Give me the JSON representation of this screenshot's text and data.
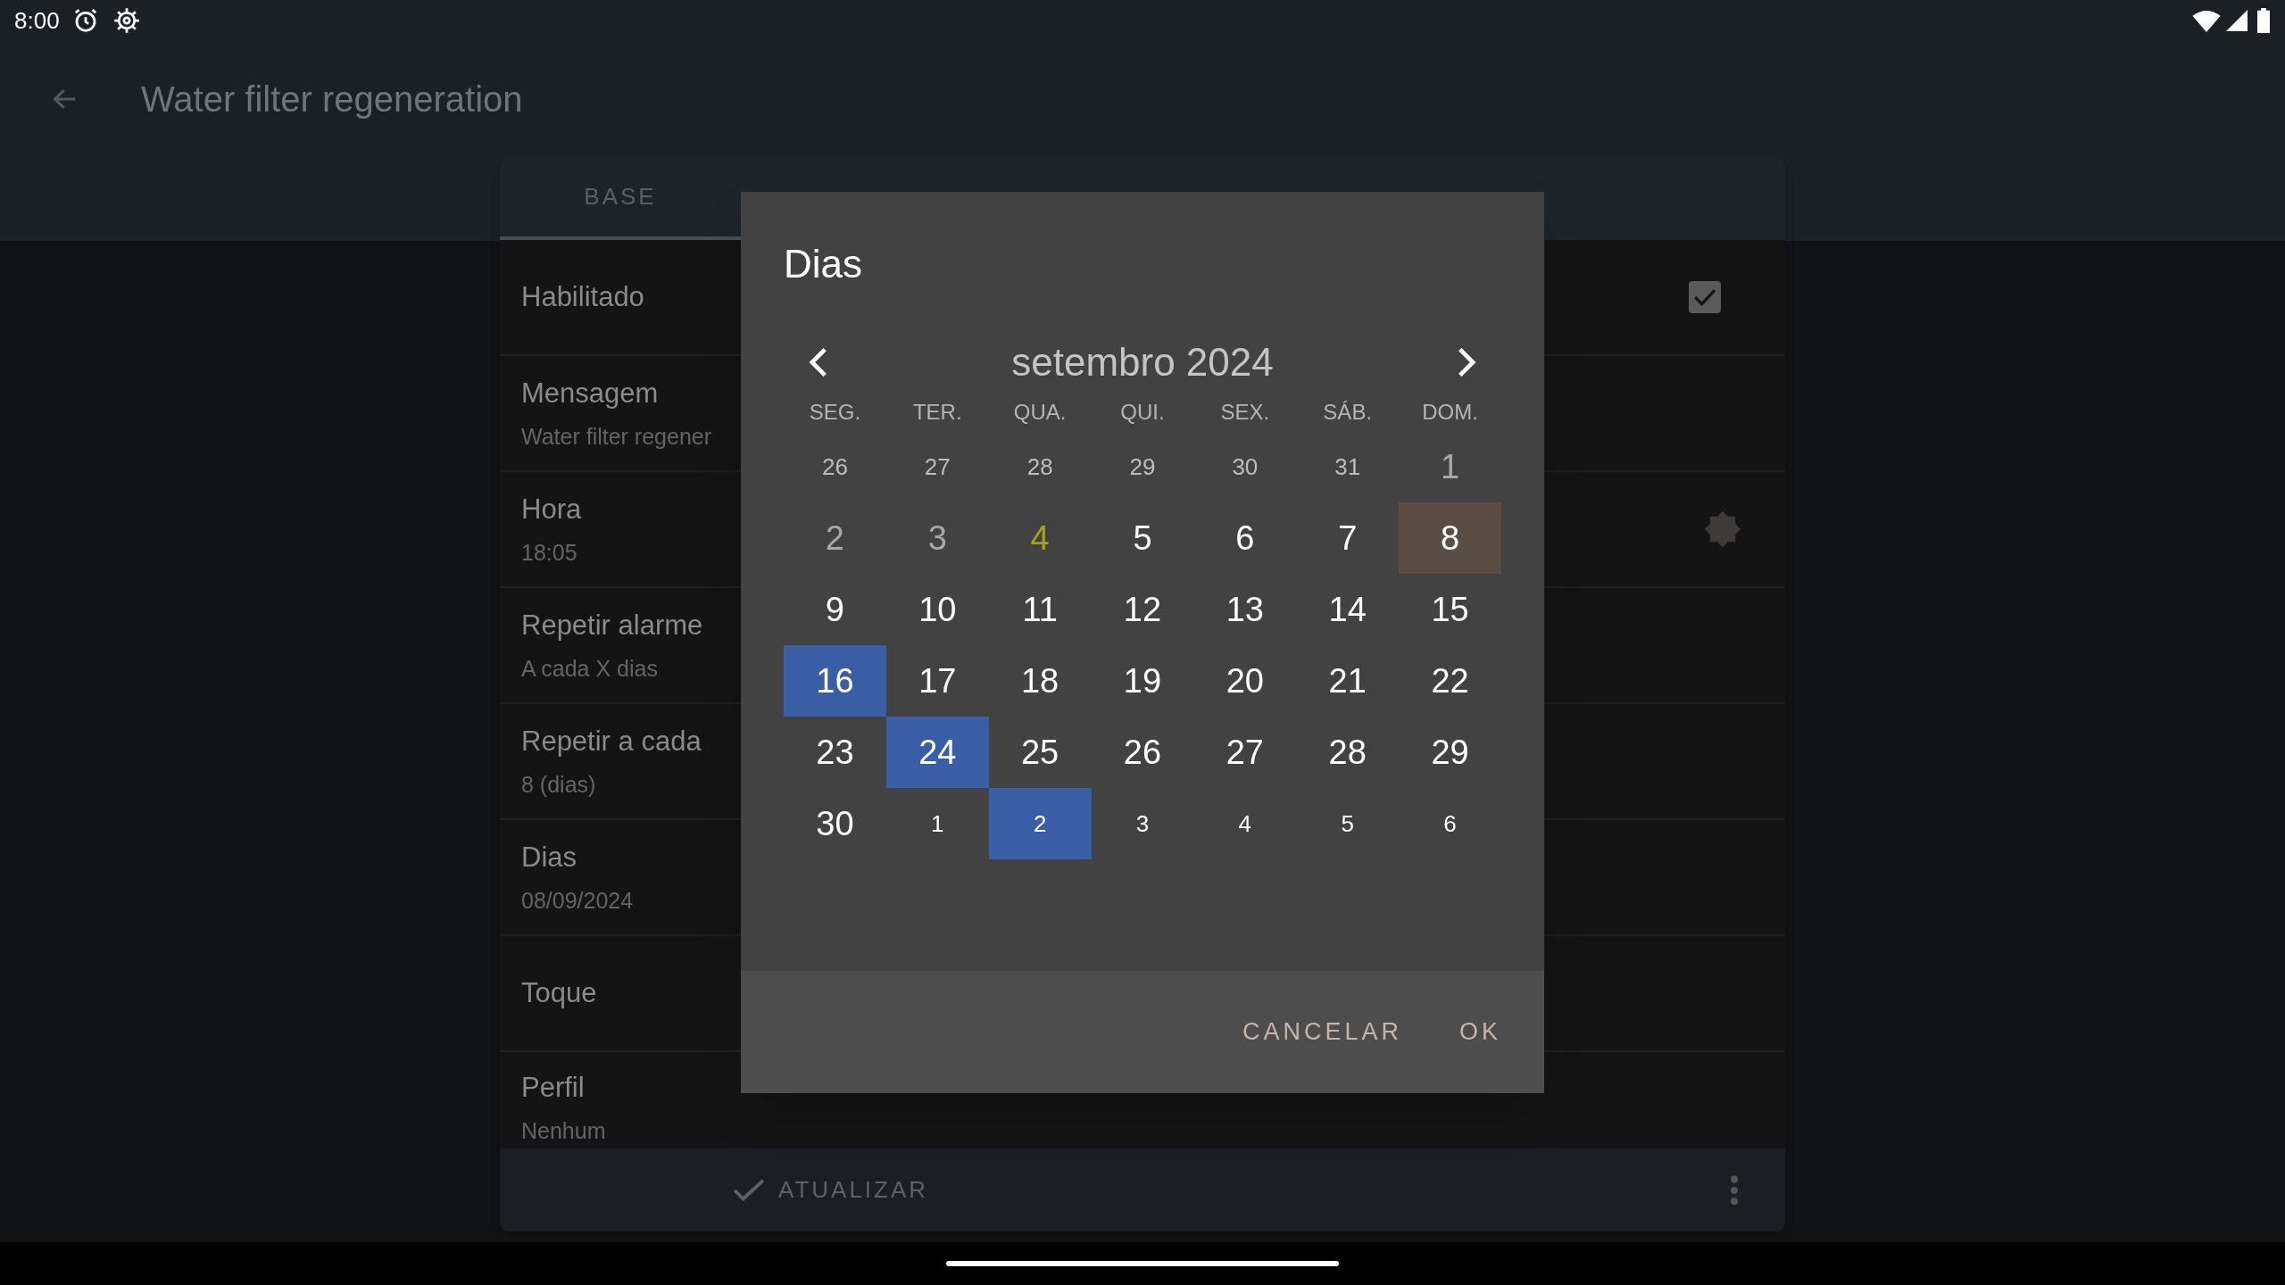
{
  "status_bar": {
    "time": "8:00"
  },
  "app_bar": {
    "title": "Water filter regeneration"
  },
  "tabs": [
    {
      "label": "BASE",
      "selected": true
    }
  ],
  "settings": [
    {
      "label": "Habilitado",
      "kind": "checkbox",
      "checked": true
    },
    {
      "label": "Mensagem",
      "value": "Water filter regener",
      "kind": "plain"
    },
    {
      "label": "Hora",
      "value": "18:05",
      "kind": "theme-icon"
    },
    {
      "label": "Repetir alarme",
      "value": "A cada X dias",
      "kind": "plain"
    },
    {
      "label": "Repetir a cada",
      "value": "8 (dias)",
      "kind": "plain"
    },
    {
      "label": "Dias",
      "value": "08/09/2024",
      "kind": "plain"
    },
    {
      "label": "Toque",
      "kind": "plain"
    },
    {
      "label": "Perfil",
      "value": "Nenhum",
      "kind": "plain"
    }
  ],
  "bottom_bar": {
    "action": "ATUALIZAR"
  },
  "dialog": {
    "title": "Dias",
    "month": "setembro 2024",
    "weekdays": [
      "SEG.",
      "TER.",
      "QUA.",
      "QUI.",
      "SEX.",
      "SÁB.",
      "DOM."
    ],
    "days": [
      {
        "label": "26",
        "kind": "prev-month",
        "selected": false,
        "marked": false
      },
      {
        "label": "27",
        "kind": "prev-month",
        "selected": false,
        "marked": false
      },
      {
        "label": "28",
        "kind": "prev-month",
        "selected": false,
        "marked": false
      },
      {
        "label": "29",
        "kind": "prev-month",
        "selected": false,
        "marked": false
      },
      {
        "label": "30",
        "kind": "prev-month",
        "selected": false,
        "marked": false
      },
      {
        "label": "31",
        "kind": "prev-month",
        "selected": false,
        "marked": false
      },
      {
        "label": "1",
        "kind": "past",
        "selected": false,
        "marked": false
      },
      {
        "label": "2",
        "kind": "past",
        "selected": false,
        "marked": false
      },
      {
        "label": "3",
        "kind": "past",
        "selected": false,
        "marked": false
      },
      {
        "label": "4",
        "kind": "today",
        "selected": false,
        "marked": false
      },
      {
        "label": "5",
        "kind": "normal",
        "selected": false,
        "marked": false
      },
      {
        "label": "6",
        "kind": "normal",
        "selected": false,
        "marked": false
      },
      {
        "label": "7",
        "kind": "normal",
        "selected": false,
        "marked": false
      },
      {
        "label": "8",
        "kind": "normal",
        "selected": true,
        "marked": false
      },
      {
        "label": "9",
        "kind": "normal",
        "selected": false,
        "marked": false
      },
      {
        "label": "10",
        "kind": "normal",
        "selected": false,
        "marked": false
      },
      {
        "label": "11",
        "kind": "normal",
        "selected": false,
        "marked": false
      },
      {
        "label": "12",
        "kind": "normal",
        "selected": false,
        "marked": false
      },
      {
        "label": "13",
        "kind": "normal",
        "selected": false,
        "marked": false
      },
      {
        "label": "14",
        "kind": "normal",
        "selected": false,
        "marked": false
      },
      {
        "label": "15",
        "kind": "normal",
        "selected": false,
        "marked": false
      },
      {
        "label": "16",
        "kind": "normal",
        "selected": false,
        "marked": true
      },
      {
        "label": "17",
        "kind": "normal",
        "selected": false,
        "marked": false
      },
      {
        "label": "18",
        "kind": "normal",
        "selected": false,
        "marked": false
      },
      {
        "label": "19",
        "kind": "normal",
        "selected": false,
        "marked": false
      },
      {
        "label": "20",
        "kind": "normal",
        "selected": false,
        "marked": false
      },
      {
        "label": "21",
        "kind": "normal",
        "selected": false,
        "marked": false
      },
      {
        "label": "22",
        "kind": "normal",
        "selected": false,
        "marked": false
      },
      {
        "label": "23",
        "kind": "normal",
        "selected": false,
        "marked": false
      },
      {
        "label": "24",
        "kind": "normal",
        "selected": false,
        "marked": true
      },
      {
        "label": "25",
        "kind": "normal",
        "selected": false,
        "marked": false
      },
      {
        "label": "26",
        "kind": "normal",
        "selected": false,
        "marked": false
      },
      {
        "label": "27",
        "kind": "normal",
        "selected": false,
        "marked": false
      },
      {
        "label": "28",
        "kind": "normal",
        "selected": false,
        "marked": false
      },
      {
        "label": "29",
        "kind": "normal",
        "selected": false,
        "marked": false
      },
      {
        "label": "30",
        "kind": "normal",
        "selected": false,
        "marked": false
      },
      {
        "label": "1",
        "kind": "next-month",
        "selected": false,
        "marked": false
      },
      {
        "label": "2",
        "kind": "next-month",
        "selected": false,
        "marked": true
      },
      {
        "label": "3",
        "kind": "next-month",
        "selected": false,
        "marked": false
      },
      {
        "label": "4",
        "kind": "next-month",
        "selected": false,
        "marked": false
      },
      {
        "label": "5",
        "kind": "next-month",
        "selected": false,
        "marked": false
      },
      {
        "label": "6",
        "kind": "next-month",
        "selected": false,
        "marked": false
      }
    ],
    "buttons": [
      "CANCELAR",
      "OK"
    ]
  }
}
